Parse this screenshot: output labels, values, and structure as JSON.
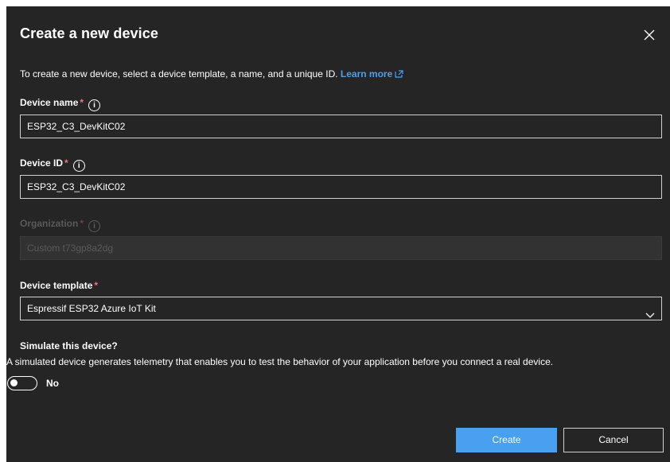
{
  "dialog": {
    "title": "Create a new device",
    "intro_text": "To create a new device, select a device template, a name, and a unique ID.",
    "learn_more": "Learn more"
  },
  "fields": {
    "device_name": {
      "label": "Device name",
      "required": "*",
      "value": "ESP32_C3_DevKitC02"
    },
    "device_id": {
      "label": "Device ID",
      "required": "*",
      "value": "ESP32_C3_DevKitC02"
    },
    "organization": {
      "label": "Organization",
      "required": "*",
      "value": "Custom t73gp8a2dg",
      "disabled": true
    },
    "device_template": {
      "label": "Device template",
      "required": "*",
      "value": "Espressif ESP32 Azure IoT Kit"
    }
  },
  "simulate": {
    "title": "Simulate this device?",
    "description": "A simulated device generates telemetry that enables you to test the behavior of your application before you connect a real device.",
    "toggle_label": "No",
    "enabled": false
  },
  "buttons": {
    "create": "Create",
    "cancel": "Cancel"
  },
  "icons": {
    "close": "close-icon",
    "info": "info-icon",
    "external_link": "external-link-icon",
    "chevron": "chevron-down-icon"
  },
  "colors": {
    "background": "#252526",
    "accent": "#4aa0f0",
    "required": "#f1707b"
  }
}
